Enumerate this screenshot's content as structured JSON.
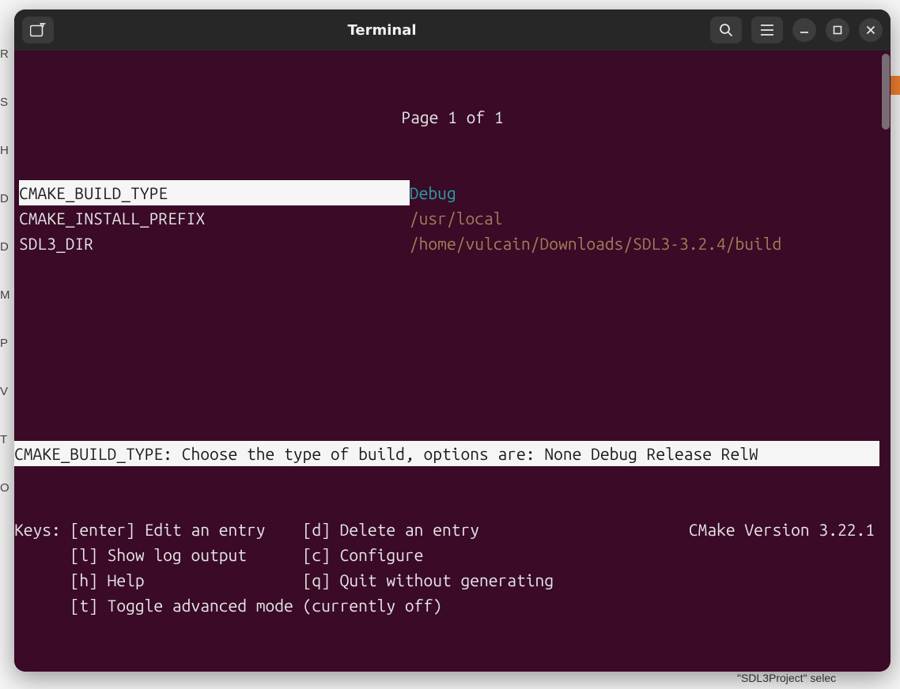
{
  "window": {
    "title": "Terminal",
    "icons": {
      "new_tab": "new-tab-icon",
      "search": "search-icon",
      "menu": "menu-icon",
      "minimize": "minimize-icon",
      "maximize": "maximize-icon",
      "close": "close-icon"
    }
  },
  "ccmake": {
    "page_indicator": "Page 1 of 1",
    "entries": [
      {
        "name": "CMAKE_BUILD_TYPE",
        "value": "Debug",
        "selected": true,
        "value_color": "cyan"
      },
      {
        "name": "CMAKE_INSTALL_PREFIX",
        "value": "/usr/local",
        "selected": false,
        "value_color": "brown"
      },
      {
        "name": "SDL3_DIR",
        "value": "/home/vulcain/Downloads/SDL3-3.2.4/build",
        "selected": false,
        "value_color": "brown"
      }
    ],
    "description": "CMAKE_BUILD_TYPE: Choose the type of build, options are: None Debug Release RelW",
    "version_label": "CMake Version 3.22.1",
    "keys": {
      "label": "Keys:",
      "lines": [
        {
          "left": "[enter] Edit an entry",
          "right": "[d] Delete an entry"
        },
        {
          "left": "[l] Show log output",
          "right": "[c] Configure"
        },
        {
          "left": "[h] Help",
          "right": "[q] Quit without generating"
        },
        {
          "left": "[t] Toggle advanced mode (currently off)",
          "right": ""
        }
      ]
    }
  },
  "background": {
    "left_strip": [
      "R",
      "S",
      "H",
      "D",
      "D",
      "M",
      "P",
      "V",
      "T",
      "O"
    ],
    "bottom_fragment": "\"SDL3Project\" selec"
  }
}
